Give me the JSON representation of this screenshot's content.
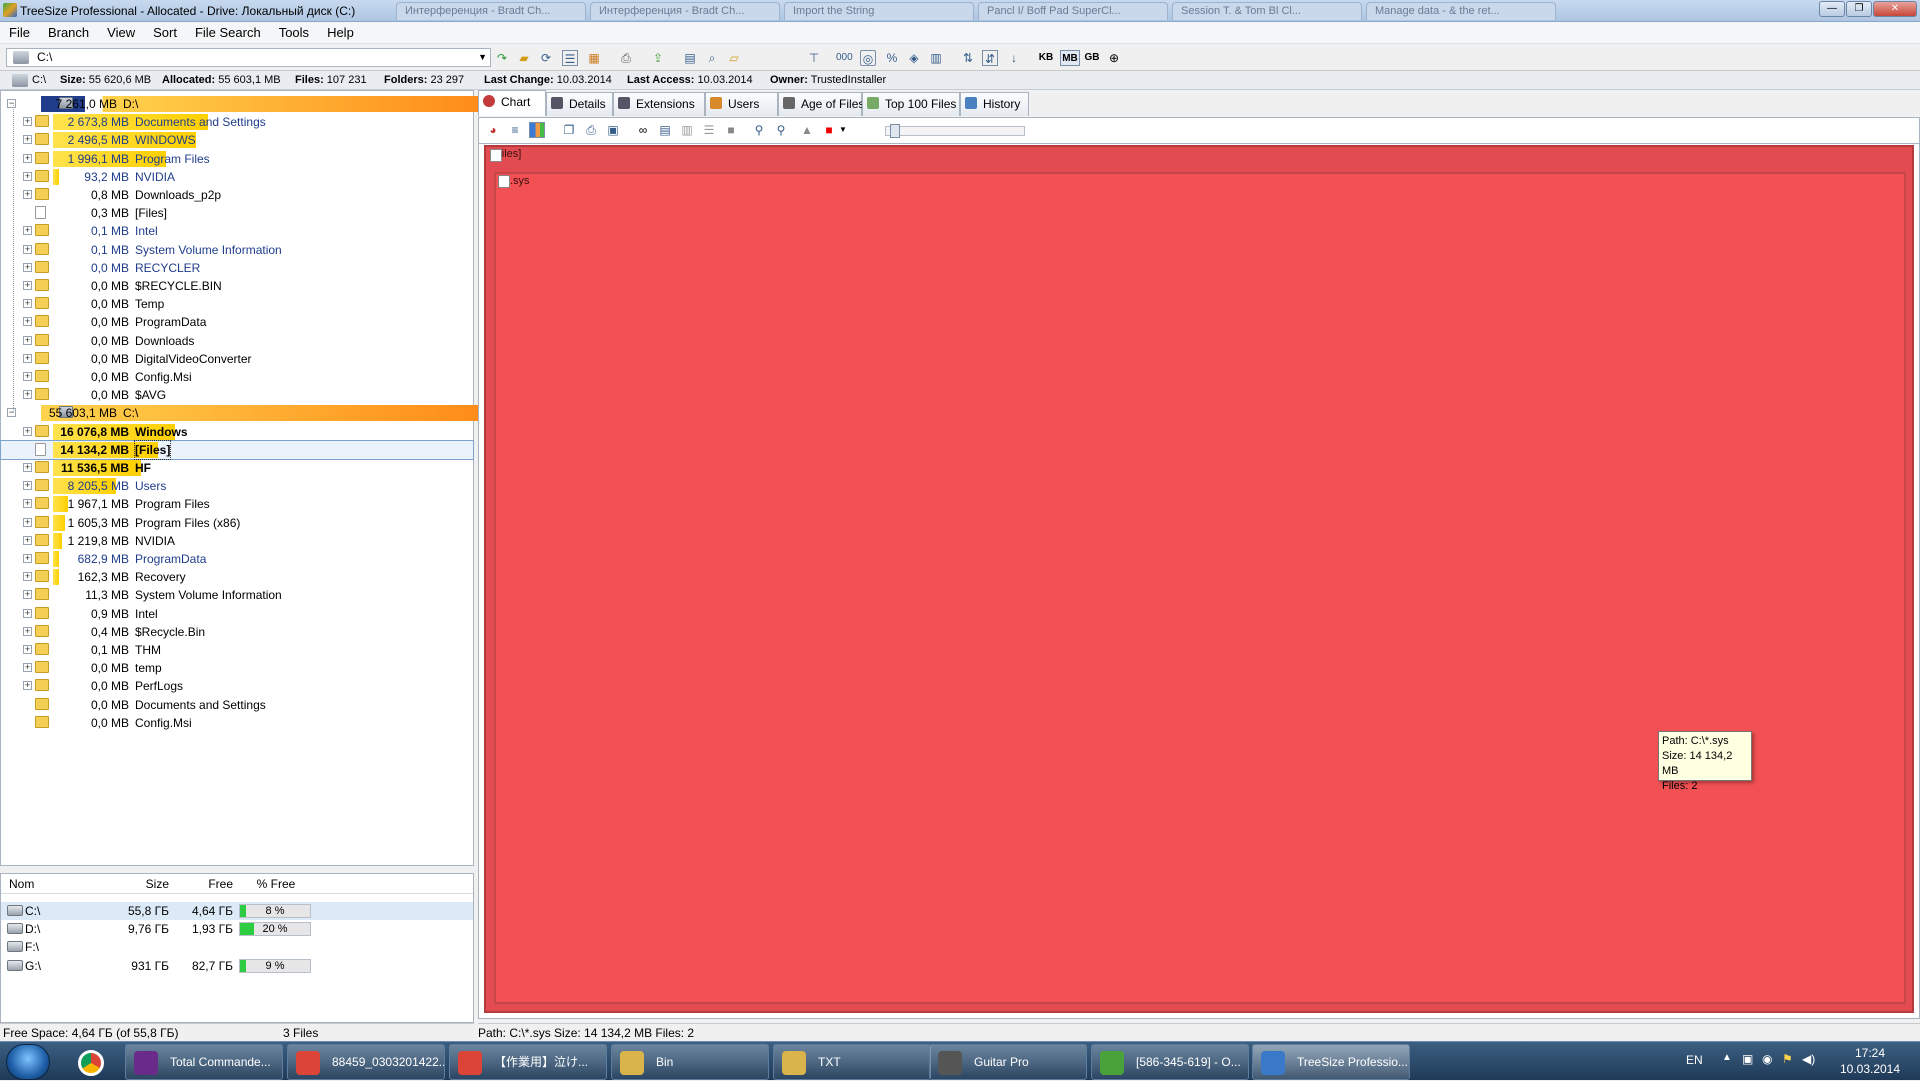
{
  "window": {
    "title": "TreeSize Professional - Allocated - Drive: Локальный диск (C:)",
    "bg_tabs": [
      "Интерференция - Bradt Ch...",
      "Интерференция - Bradt Ch...",
      "Import the String",
      "Pancl I/ Boff Pad SuperCl...",
      "Session T. & Tom Bl Cl...",
      "Manage data - & the ret..."
    ],
    "minimize": "—",
    "maximize": "❐",
    "close": "✕"
  },
  "menu": [
    "File",
    "Branch",
    "View",
    "Sort",
    "File Search",
    "Tools",
    "Help"
  ],
  "toolbar": {
    "path": "C:\\",
    "units": [
      "KB",
      "MB",
      "GB"
    ],
    "active_unit": "MB"
  },
  "infobar": {
    "drive": "C:\\",
    "size_label": "Size:",
    "size": "55 620,6 MB",
    "allocated_label": "Allocated:",
    "allocated": "55 603,1 MB",
    "files_label": "Files:",
    "files": "107 231",
    "folders_label": "Folders:",
    "folders": "23 297",
    "last_change_label": "Last Change:",
    "last_change": "10.03.2014",
    "last_access_label": "Last Access:",
    "last_access": "10.03.2014",
    "owner_label": "Owner:",
    "owner": "TrustedInstaller"
  },
  "tree": [
    {
      "size": "7 261,0 MB",
      "name": "D:\\",
      "level": 0,
      "bar": 1.0,
      "type": "drive",
      "color": "#1f3d8a"
    },
    {
      "size": "2 673,8 MB",
      "name": "Documents and Settings",
      "level": 1,
      "bar": 0.37,
      "blue": true
    },
    {
      "size": "2 496,5 MB",
      "name": "WINDOWS",
      "level": 1,
      "bar": 0.34,
      "blue": true
    },
    {
      "size": "1 996,1 MB",
      "name": "Program Files",
      "level": 1,
      "bar": 0.27,
      "blue": true
    },
    {
      "size": "93,2 MB",
      "name": "NVIDIA",
      "level": 1,
      "bar": 0.013,
      "blue": true
    },
    {
      "size": "0,8 MB",
      "name": "Downloads_p2p",
      "level": 1,
      "bar": 0
    },
    {
      "size": "0,3 MB",
      "name": "[Files]",
      "level": 1,
      "bar": 0,
      "type": "file"
    },
    {
      "size": "0,1 MB",
      "name": "Intel",
      "level": 1,
      "bar": 0,
      "blue": true
    },
    {
      "size": "0,1 MB",
      "name": "System Volume Information",
      "level": 1,
      "bar": 0,
      "blue": true
    },
    {
      "size": "0,0 MB",
      "name": "RECYCLER",
      "level": 1,
      "bar": 0,
      "blue": true
    },
    {
      "size": "0,0 MB",
      "name": "$RECYCLE.BIN",
      "level": 1,
      "bar": 0
    },
    {
      "size": "0,0 MB",
      "name": "Temp",
      "level": 1,
      "bar": 0
    },
    {
      "size": "0,0 MB",
      "name": "ProgramData",
      "level": 1,
      "bar": 0
    },
    {
      "size": "0,0 MB",
      "name": "Downloads",
      "level": 1,
      "bar": 0
    },
    {
      "size": "0,0 MB",
      "name": "DigitalVideoConverter",
      "level": 1,
      "bar": 0
    },
    {
      "size": "0,0 MB",
      "name": "Config.Msi",
      "level": 1,
      "bar": 0
    },
    {
      "size": "0,0 MB",
      "name": "$AVG",
      "level": 1,
      "bar": 0
    },
    {
      "size": "55 603,1 MB",
      "name": "C:\\",
      "level": 0,
      "bar": 1.0,
      "type": "drive",
      "color": "#ff8c1a"
    },
    {
      "size": "16 076,8 MB",
      "name": "Windows",
      "level": 1,
      "bar": 0.29,
      "bold": true
    },
    {
      "size": "14 134,2 MB",
      "name": "[Files]",
      "level": 1,
      "bar": 0.25,
      "bold": true,
      "type": "file",
      "selected": true
    },
    {
      "size": "11 536,5 MB",
      "name": "HF",
      "level": 1,
      "bar": 0.21,
      "bold": true
    },
    {
      "size": "8 205,5 MB",
      "name": "Users",
      "level": 1,
      "bar": 0.15,
      "blue": true
    },
    {
      "size": "1 967,1 MB",
      "name": "Program Files",
      "level": 1,
      "bar": 0.035
    },
    {
      "size": "1 605,3 MB",
      "name": "Program Files (x86)",
      "level": 1,
      "bar": 0.029
    },
    {
      "size": "1 219,8 MB",
      "name": "NVIDIA",
      "level": 1,
      "bar": 0.022
    },
    {
      "size": "682,9 MB",
      "name": "ProgramData",
      "level": 1,
      "bar": 0.012,
      "blue": true
    },
    {
      "size": "162,3 MB",
      "name": "Recovery",
      "level": 1,
      "bar": 0.003
    },
    {
      "size": "11,3 MB",
      "name": "System Volume Information",
      "level": 1,
      "bar": 0
    },
    {
      "size": "0,9 MB",
      "name": "Intel",
      "level": 1,
      "bar": 0
    },
    {
      "size": "0,4 MB",
      "name": "$Recycle.Bin",
      "level": 1,
      "bar": 0
    },
    {
      "size": "0,1 MB",
      "name": "THM",
      "level": 1,
      "bar": 0
    },
    {
      "size": "0,0 MB",
      "name": "temp",
      "level": 1,
      "bar": 0
    },
    {
      "size": "0,0 MB",
      "name": "PerfLogs",
      "level": 1,
      "bar": 0
    },
    {
      "size": "0,0 MB",
      "name": "Documents and Settings",
      "level": 1,
      "bar": 0,
      "noexp": true
    },
    {
      "size": "0,0 MB",
      "name": "Config.Msi",
      "level": 1,
      "bar": 0,
      "noexp": true
    }
  ],
  "drives": {
    "headers": {
      "name": "Nom",
      "size": "Size",
      "free": "Free",
      "pct": "% Free"
    },
    "rows": [
      {
        "name": "C:\\",
        "size": "55,8 ГБ",
        "free": "4,64 ГБ",
        "pct_label": "8 %",
        "pct": 0.08,
        "selected": true
      },
      {
        "name": "D:\\",
        "size": "9,76 ГБ",
        "free": "1,93 ГБ",
        "pct_label": "20 %",
        "pct": 0.2
      },
      {
        "name": "F:\\",
        "size": "",
        "free": "",
        "pct_label": "",
        "pct": null
      },
      {
        "name": "G:\\",
        "size": "931 ГБ",
        "free": "82,7 ГБ",
        "pct_label": "9 %",
        "pct": 0.09
      }
    ]
  },
  "left_status": {
    "free": "Free Space: 4,64 ГБ  (of 55,8 ГБ)",
    "files": "3  Files"
  },
  "tabs": [
    "Chart",
    "Details",
    "Extensions",
    "Users",
    "Age of Files",
    "Top 100 Files",
    "History"
  ],
  "active_tab": "Chart",
  "chart": {
    "outer_label": "[Files]",
    "inner_label": ".sys",
    "outer_color": "#e24b4f",
    "inner_color": "#f25052"
  },
  "tooltip": {
    "path": "Path: C:\\*.sys",
    "size": "Size: 14 134,2 MB",
    "files": "Files: 2"
  },
  "right_status": "Path: C:\\*.sys  Size: 14 134,2 MB  Files: 2",
  "taskbar": {
    "items": [
      "Total Commande...",
      "88459_0303201422...",
      "【作業用】泣け...",
      "Bin",
      "TXT",
      "Guitar Pro",
      "[586-345-619] - O...",
      "TreeSize Professio..."
    ],
    "lang": "EN",
    "time": "17:24",
    "date": "10.03.2014"
  }
}
